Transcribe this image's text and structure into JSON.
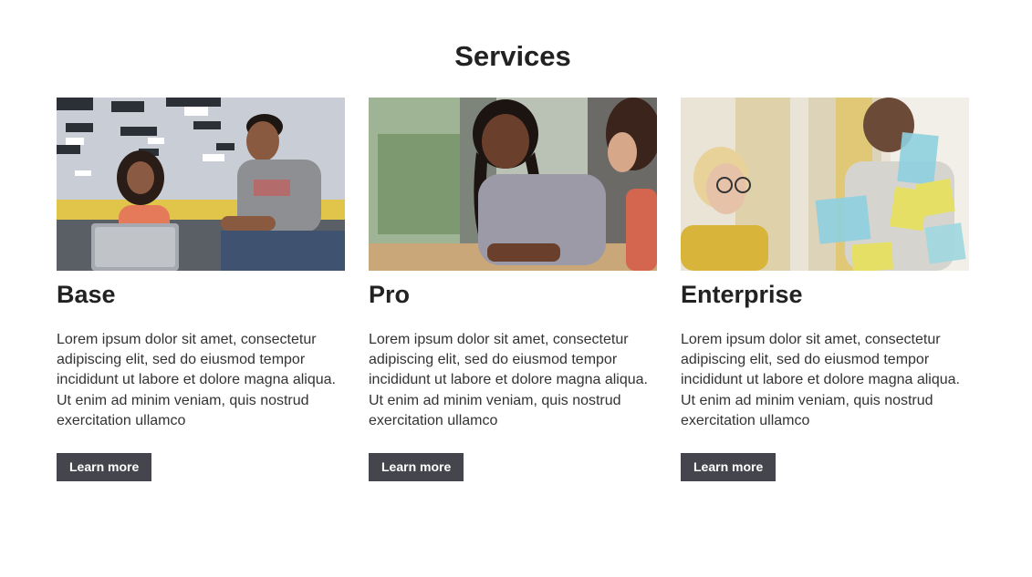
{
  "section": {
    "title": "Services"
  },
  "cards": [
    {
      "title": "Base",
      "text": "Lorem ipsum dolor sit amet, consectetur adipiscing elit, sed do eiusmod tempor incididunt ut labore et dolore magna aliqua. Ut enim ad minim veniam, quis nostrud exercitation ullamco",
      "button": "Learn more"
    },
    {
      "title": "Pro",
      "text": "Lorem ipsum dolor sit amet, consectetur adipiscing elit, sed do eiusmod tempor incididunt ut labore et dolore magna aliqua. Ut enim ad minim veniam, quis nostrud exercitation ullamco",
      "button": "Learn more"
    },
    {
      "title": "Enterprise",
      "text": "Lorem ipsum dolor sit amet, consectetur adipiscing elit, sed do eiusmod tempor incididunt ut labore et dolore magna aliqua. Ut enim ad minim veniam, quis nostrud exercitation ullamco",
      "button": "Learn more"
    }
  ],
  "colors": {
    "button_bg": "#45464d",
    "heading": "#222222",
    "body_text": "#333333"
  }
}
